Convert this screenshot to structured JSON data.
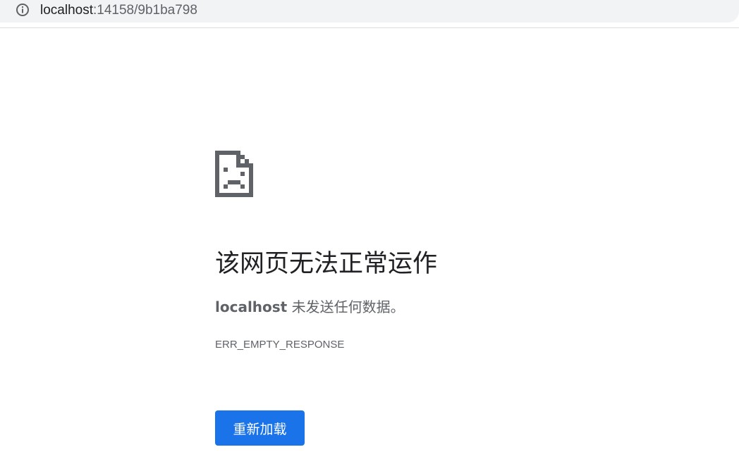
{
  "address_bar": {
    "url_host": "localhost",
    "url_rest": ":14158/9b1ba798",
    "info_icon": "info-icon"
  },
  "error_page": {
    "icon": "sad-page-icon",
    "heading": "该网页无法正常运作",
    "host": "localhost",
    "message": " 未发送任何数据。",
    "error_code": "ERR_EMPTY_RESPONSE",
    "reload_label": "重新加载"
  },
  "colors": {
    "accent": "#1a73e8",
    "text_primary": "#202124",
    "text_secondary": "#5f6368",
    "omnibox_bg": "#f1f3f4"
  }
}
